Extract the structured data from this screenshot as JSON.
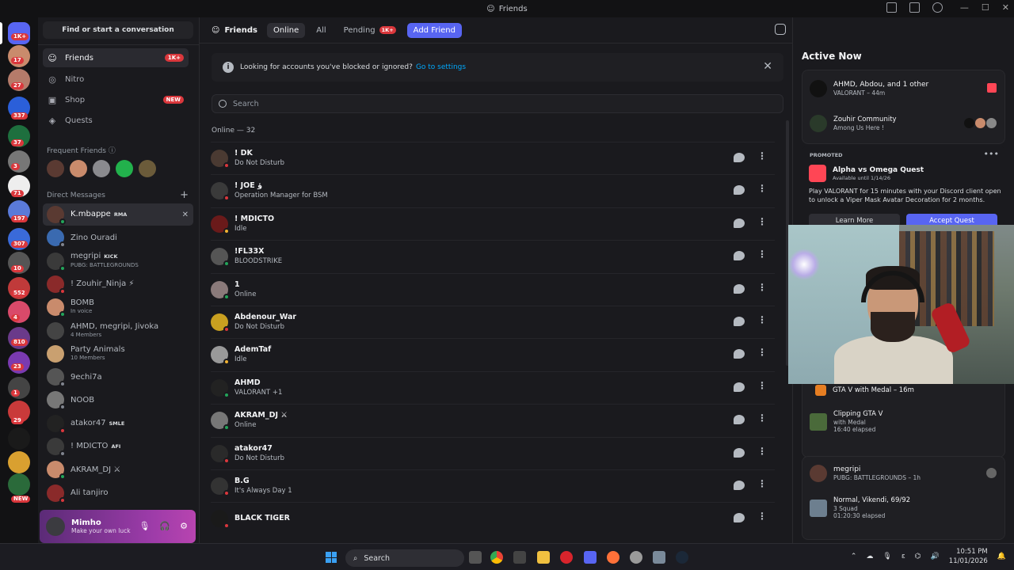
{
  "window": {
    "title": "Friends"
  },
  "sidebar": {
    "search_label": "Find or start a conversation",
    "nav": [
      {
        "label": "Friends",
        "badge": "1K+"
      },
      {
        "label": "Nitro"
      },
      {
        "label": "Shop",
        "badge": "NEW"
      },
      {
        "label": "Quests"
      }
    ],
    "frequent_label": "Frequent Friends",
    "dm_label": "Direct Messages",
    "dms": [
      {
        "name": "K.mbappe",
        "tag": "RMA",
        "sub": ""
      },
      {
        "name": "Zino Ouradi",
        "sub": ""
      },
      {
        "name": "megripi",
        "tag": "KICK",
        "sub": "PUBG: BATTLEGROUNDS"
      },
      {
        "name": "! Zouhir_Ninja ⚡",
        "sub": ""
      },
      {
        "name": "BOMB",
        "sub": "In voice"
      },
      {
        "name": "AHMD, megripi, Jivoka",
        "sub": "4 Members"
      },
      {
        "name": "Party Animals",
        "sub": "10 Members"
      },
      {
        "name": "9echi7a",
        "sub": ""
      },
      {
        "name": "NOOB",
        "sub": ""
      },
      {
        "name": "atakor47",
        "tag": "SMLE",
        "sub": ""
      },
      {
        "name": "! MDICTO",
        "tag": "AFI",
        "sub": ""
      },
      {
        "name": "AKRAM_DJ ⚔",
        "sub": ""
      },
      {
        "name": "Ali tanjiro",
        "sub": ""
      }
    ],
    "user": {
      "name": "Mimho",
      "status": "Make your own luck"
    }
  },
  "rail_badges": [
    "1K+",
    "17",
    "27",
    "337",
    "37",
    "3",
    "71",
    "197",
    "307",
    "10",
    "552",
    "4",
    "810",
    "23",
    "1",
    "29",
    "NEW"
  ],
  "main": {
    "header": "Friends",
    "tabs": [
      {
        "label": "Online",
        "active": true
      },
      {
        "label": "All"
      },
      {
        "label": "Pending",
        "badge": "1K+"
      },
      {
        "label": "Add Friend",
        "primary": true
      }
    ],
    "notice_text": "Looking for accounts you've blocked or ignored?",
    "notice_link": "Go to settings",
    "search_placeholder": "Search",
    "online_count": "Online — 32",
    "friends": [
      {
        "name": "! DK",
        "status": "Do Not Disturb",
        "color": "#da373c"
      },
      {
        "name": "! JOE ؤ",
        "status": "Operation Manager for BSM",
        "color": "#da373c"
      },
      {
        "name": "! MDICTO",
        "status": "Idle",
        "color": "#f0b232"
      },
      {
        "name": "!FL33X",
        "status": "BLOODSTRIKE",
        "color": "#23a55a"
      },
      {
        "name": "1",
        "status": "Online",
        "color": "#23a55a"
      },
      {
        "name": "Abdenour_War",
        "status": "Do Not Disturb",
        "color": "#da373c"
      },
      {
        "name": "AdemTaf",
        "status": "Idle",
        "color": "#f0b232"
      },
      {
        "name": "AHMD",
        "status": "VALORANT +1",
        "color": "#23a55a"
      },
      {
        "name": "AKRAM_DJ ⚔",
        "status": "Online",
        "color": "#23a55a"
      },
      {
        "name": "atakor47",
        "status": "Do Not Disturb",
        "color": "#da373c"
      },
      {
        "name": "B.G",
        "status": "It's Always Day 1",
        "color": "#da373c"
      },
      {
        "name": "BLACK TIGER",
        "status": "",
        "color": "#da373c"
      }
    ]
  },
  "active_now": {
    "title": "Active Now",
    "card1": {
      "title": "AHMD, Abdou, and 1 other",
      "sub": "VALORANT – 44m",
      "community": "Zouhir Community",
      "community_sub": "Among Us Here !"
    },
    "promo": {
      "tag": "PROMOTED",
      "title": "Alpha vs Omega Quest",
      "avail": "Available until 1/14/26",
      "desc": "Play VALORANT for 15 minutes with your Discord client open to unlock a Viper Mask Avatar Decoration for 2 months.",
      "learn": "Learn More",
      "accept": "Accept Quest"
    },
    "card2": {
      "sub": "GTA V with Medal – 16m",
      "clip_title": "Clipping GTA V",
      "clip_sub": "with Medal",
      "clip_time": "16:40 elapsed"
    },
    "card3": {
      "name": "megripi",
      "sub": "PUBG: BATTLEGROUNDS – 1h",
      "game_title": "Normal, Vikendi, 69/92",
      "game_sub": "3 Squad",
      "game_time": "01:20:30 elapsed"
    }
  },
  "taskbar": {
    "search": "Search",
    "time": "10:51 PM",
    "date": "11/01/2026"
  }
}
